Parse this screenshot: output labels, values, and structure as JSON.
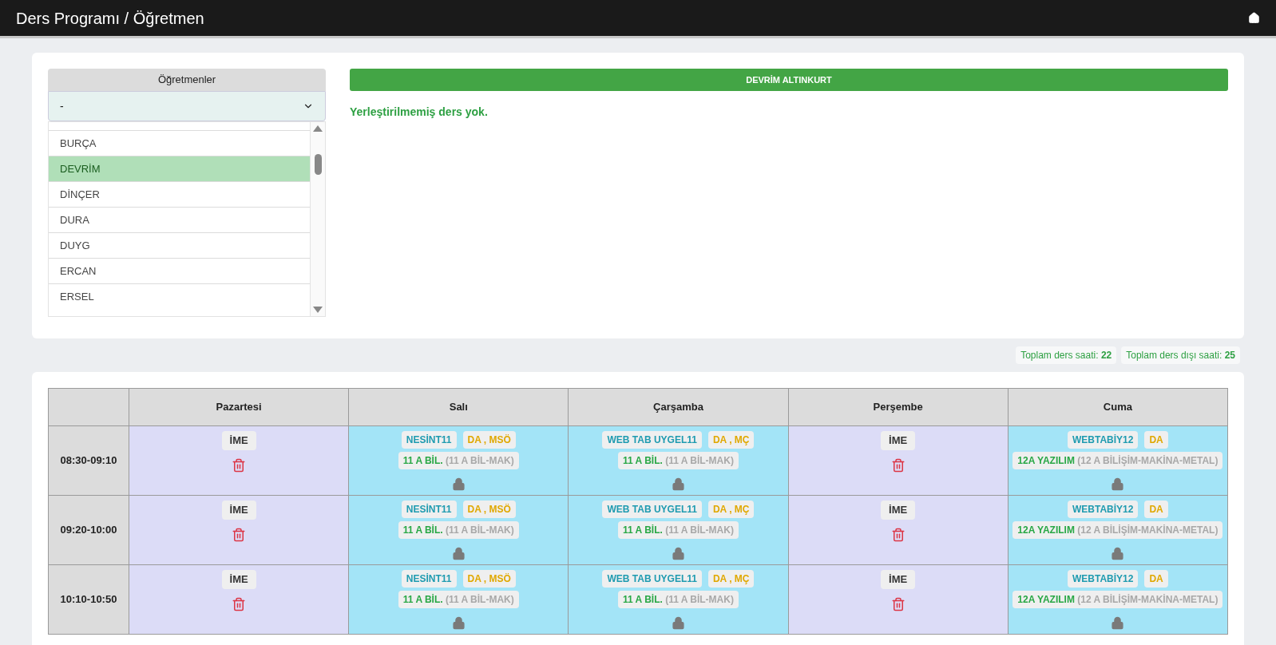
{
  "header": {
    "title": "Ders Programı / Öğretmen"
  },
  "teachers": {
    "heading": "Öğretmenler",
    "select_value": "-",
    "items": [
      {
        "name": "BURÇA",
        "selected": false
      },
      {
        "name": "DEVRİM",
        "selected": true
      },
      {
        "name": "DİNÇER",
        "selected": false
      },
      {
        "name": "DURA",
        "selected": false
      },
      {
        "name": "DUYG",
        "selected": false
      },
      {
        "name": "ERCAN",
        "selected": false
      },
      {
        "name": "ERSEL",
        "selected": false
      }
    ]
  },
  "selected_teacher": "DEVRİM ALTINKURT",
  "unplaced_message": "Yerleştirilmemiş ders yok.",
  "totals": [
    {
      "label": "Toplam ders saati:",
      "value": "22"
    },
    {
      "label": "Toplam ders dışı saati:",
      "value": "25"
    }
  ],
  "schedule": {
    "days": [
      "Pazartesi",
      "Salı",
      "Çarşamba",
      "Perşembe",
      "Cuma"
    ],
    "rows": [
      {
        "time": "08:30-09:10",
        "cells": [
          {
            "kind": "free",
            "label": "İME"
          },
          {
            "kind": "lesson",
            "course": "NESİNT11",
            "teacher": "DA , MSÖ",
            "class": "11 A BİL.",
            "class_full": "(11 A BİL-MAK)"
          },
          {
            "kind": "lesson",
            "course": "WEB TAB UYGEL11",
            "teacher": "DA , MÇ",
            "class": "11 A BİL.",
            "class_full": "(11 A BİL-MAK)"
          },
          {
            "kind": "free",
            "label": "İME"
          },
          {
            "kind": "lesson",
            "course": "WEBTABİY12",
            "teacher": "DA",
            "class": "12A YAZILIM",
            "class_full": "(12 A BİLİŞİM-MAKİNA-METAL)"
          }
        ]
      },
      {
        "time": "09:20-10:00",
        "cells": [
          {
            "kind": "free",
            "label": "İME"
          },
          {
            "kind": "lesson",
            "course": "NESİNT11",
            "teacher": "DA , MSÖ",
            "class": "11 A BİL.",
            "class_full": "(11 A BİL-MAK)"
          },
          {
            "kind": "lesson",
            "course": "WEB TAB UYGEL11",
            "teacher": "DA , MÇ",
            "class": "11 A BİL.",
            "class_full": "(11 A BİL-MAK)"
          },
          {
            "kind": "free",
            "label": "İME"
          },
          {
            "kind": "lesson",
            "course": "WEBTABİY12",
            "teacher": "DA",
            "class": "12A YAZILIM",
            "class_full": "(12 A BİLİŞİM-MAKİNA-METAL)"
          }
        ]
      },
      {
        "time": "10:10-10:50",
        "cells": [
          {
            "kind": "free",
            "label": "İME"
          },
          {
            "kind": "lesson",
            "course": "NESİNT11",
            "teacher": "DA , MSÖ",
            "class": "11 A BİL.",
            "class_full": "(11 A BİL-MAK)"
          },
          {
            "kind": "lesson",
            "course": "WEB TAB UYGEL11",
            "teacher": "DA , MÇ",
            "class": "11 A BİL.",
            "class_full": "(11 A BİL-MAK)"
          },
          {
            "kind": "free",
            "label": "İME"
          },
          {
            "kind": "lesson",
            "course": "WEBTABİY12",
            "teacher": "DA",
            "class": "12A YAZILIM",
            "class_full": "(12 A BİLİŞİM-MAKİNA-METAL)"
          }
        ]
      }
    ]
  }
}
